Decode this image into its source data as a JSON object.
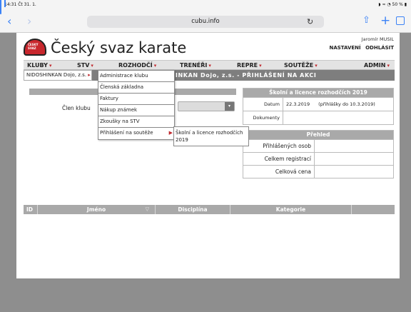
{
  "ios": {
    "time": "14:31",
    "date": "Čt 31. 1.",
    "battery": "50 %",
    "url": "cubu.info"
  },
  "site": {
    "title": "Český svaz karate",
    "logo_text": "ČESKÝ SVAZ",
    "user_name": "Jaromír MUSIL",
    "settings_link": "NASTAVENÍ",
    "logout_link": "ODHLÁSIT"
  },
  "menu": [
    {
      "label": "KLUBY"
    },
    {
      "label": "STV"
    },
    {
      "label": "ROZHODČÍ"
    },
    {
      "label": "TRENÉŘI"
    },
    {
      "label": "REPRE"
    },
    {
      "label": "SOUTĚŽE"
    },
    {
      "label": "ADMIN"
    }
  ],
  "breadcrumb": {
    "club": "NIDOSHINKAN Dojo, z.s.",
    "page_title": "DSHINKAN Dojo, z.s. - PŘIHLÁŠENÍ NA AKCI"
  },
  "dropdown": [
    {
      "label": "Administrace klubu"
    },
    {
      "label": "Členská základna"
    },
    {
      "label": "Faktury"
    },
    {
      "label": "Nákup známek"
    },
    {
      "label": "Zkoušky na STV"
    },
    {
      "label": "Přihlášení na soutěže"
    }
  ],
  "submenu": {
    "label": "Školní a licence rozhodčích 2019"
  },
  "form": {
    "member_label": "Člen klubu"
  },
  "info": {
    "title": "Školní a licence rozhodčích 2019",
    "date_label": "Datum",
    "date_value": "22.3.2019",
    "date_note": "(přihlášky do 10.3.2019)",
    "docs_label": "Dokumenty"
  },
  "overview": {
    "title": "Přehled",
    "rows": [
      {
        "label": "Přihlášených osob"
      },
      {
        "label": "Celkem registrací"
      },
      {
        "label": "Celková cena"
      }
    ]
  },
  "table": {
    "columns": [
      "ID",
      "Jméno",
      "Disciplína",
      "Kategorie"
    ]
  },
  "colors": {
    "accent": "#c0282d",
    "header_gray": "#a9a9a9",
    "ios_blue": "#3b82f6"
  }
}
